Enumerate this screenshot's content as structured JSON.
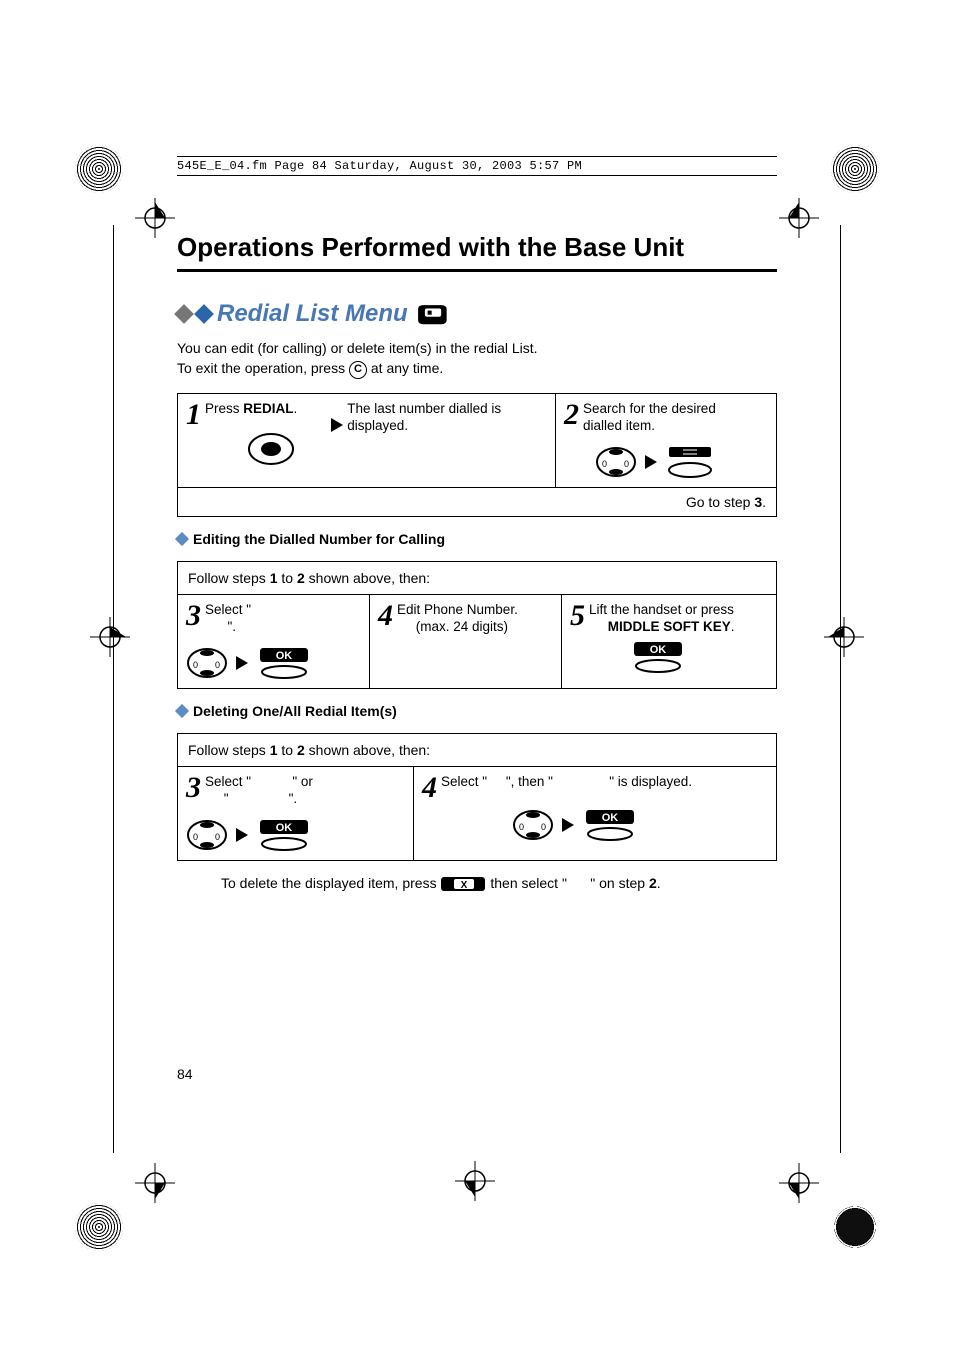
{
  "header": {
    "file_line": "545E_E_04.fm  Page 84  Saturday, August 30, 2003  5:57 PM"
  },
  "h1": "Operations Performed with the Base Unit",
  "section_title": "Redial List Menu",
  "intro": {
    "line1": "You can edit (for calling) or delete item(s) in the redial List.",
    "line2a": "To exit the operation, press ",
    "line2b": " at any time."
  },
  "circled_key": "C",
  "steps1": {
    "s1_num": "1",
    "s1_a": "Press ",
    "s1_b": "REDIAL",
    "s1_c": ".",
    "mid_arrow_text": "The last number dialled is displayed.",
    "s2_num": "2",
    "s2_text": "Search for the desired dialled item.",
    "go_a": "Go to step ",
    "go_b": "3",
    "go_c": "."
  },
  "sub_edit": "Editing the Dialled Number for Calling",
  "follow_a": "Follow steps ",
  "follow_1": "1",
  "follow_mid": " to ",
  "follow_2": "2",
  "follow_b": " shown above, then:",
  "edit": {
    "s3_num": "3",
    "s3_a": "Select \"",
    "s3_gap": "",
    "s3_b": "\".",
    "s4_num": "4",
    "s4_a": "Edit Phone Number.",
    "s4_b": "(max. 24 digits)",
    "s5_num": "5",
    "s5_a": "Lift the handset or press",
    "s5_b": "MIDDLE SOFT KEY",
    "s5_c": "."
  },
  "sub_delete": "Deleting One/All Redial Item(s)",
  "del": {
    "s3_num": "3",
    "s3_a": "Select \"",
    "s3_mid": "\" or",
    "s3_b": "\"",
    "s3_c": "\".",
    "s4_num": "4",
    "s4_a": "Select \"",
    "s4_b": "\",  then \"",
    "s4_c": "\" is displayed."
  },
  "ok_label": "OK",
  "erase_label": "X",
  "footnote": {
    "a": "To delete the displayed item,  press ",
    "b": " then select \"",
    "c": "\" on step ",
    "d": "2",
    "e": "."
  },
  "page_number": "84"
}
